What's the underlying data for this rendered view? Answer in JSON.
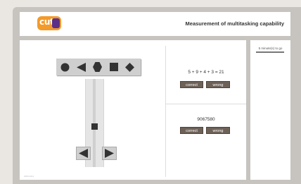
{
  "header": {
    "logo_text": "cut",
    "title": "Measurement of multitasking capability"
  },
  "timer": {
    "label": "5 minute(s) to go"
  },
  "shape_task": {
    "shapes": [
      "circle-icon",
      "triangle-left-icon",
      "hexagon-icon",
      "square-icon",
      "diamond-icon"
    ],
    "arrows": [
      "triangle-left-icon",
      "triangle-right-icon"
    ]
  },
  "math_task": {
    "equation": "5 + 9 + 4 + 3 = 21",
    "correct_label": "correct",
    "wrong_label": "wrong"
  },
  "number_task": {
    "number": "9067580",
    "correct_label": "correct",
    "wrong_label": "wrong"
  },
  "footer": {
    "text": "2006-2011"
  },
  "colors": {
    "background": "#c7c4c0",
    "logo_orange": "#f39a2a",
    "logo_purple": "#5b2f88",
    "button": "#6e6258"
  }
}
